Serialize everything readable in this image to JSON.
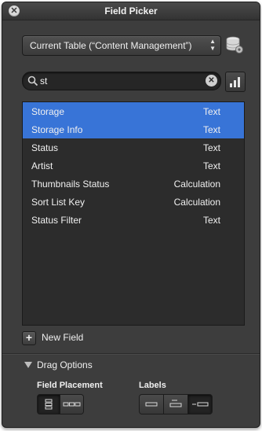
{
  "window": {
    "title": "Field Picker"
  },
  "table_select": {
    "value": "Current Table (“Content Management”)"
  },
  "search": {
    "value": "st",
    "placeholder": ""
  },
  "fields": [
    {
      "name": "Storage",
      "type": "Text",
      "selected": true
    },
    {
      "name": "Storage Info",
      "type": "Text",
      "selected": true
    },
    {
      "name": "Status",
      "type": "Text",
      "selected": false
    },
    {
      "name": "Artist",
      "type": "Text",
      "selected": false
    },
    {
      "name": "Thumbnails Status",
      "type": "Calculation",
      "selected": false
    },
    {
      "name": "Sort List Key",
      "type": "Calculation",
      "selected": false
    },
    {
      "name": "Status Filter",
      "type": "Text",
      "selected": false
    }
  ],
  "new_field": {
    "label": "New Field"
  },
  "drag_options": {
    "label": "Drag Options",
    "field_placement": {
      "label": "Field Placement",
      "selected_index": 0
    },
    "labels": {
      "label": "Labels",
      "selected_index": 2
    }
  },
  "colors": {
    "selection": "#3874d7",
    "panel": "#3d3d3d",
    "list_bg": "#2c2c2c"
  },
  "icons": [
    "close-icon",
    "chevron-updown-icon",
    "database-gear-icon",
    "search-icon",
    "clear-icon",
    "bar-chart-icon",
    "plus-icon",
    "triangle-down-icon"
  ]
}
